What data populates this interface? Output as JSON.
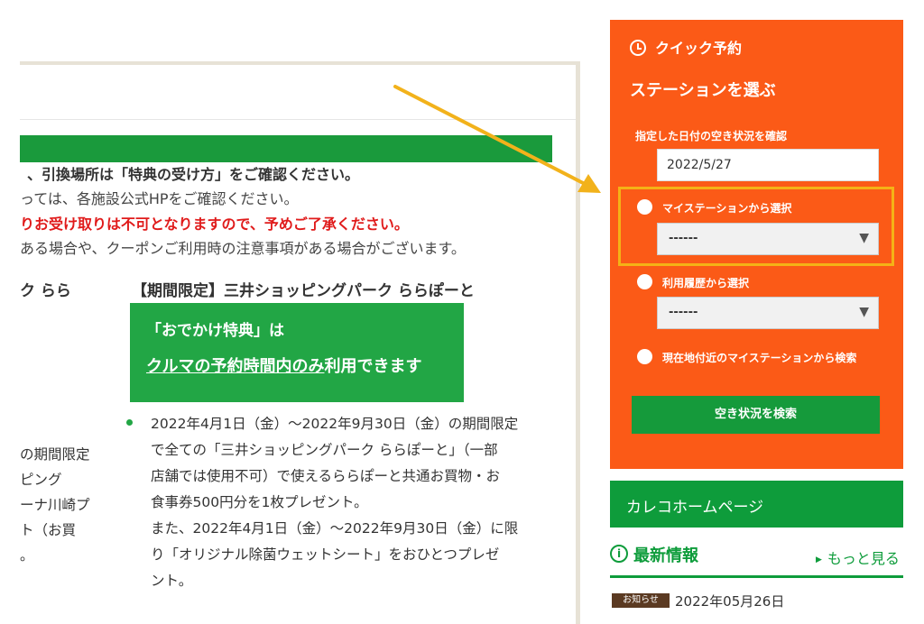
{
  "left": {
    "notice_bold": "、引換場所は「特典の受け方」をご確認ください。",
    "notice_2": "っては、各施設公式HPをご確認ください。",
    "notice_red": "りお受け取りは不可となりますので、予めご了承ください。",
    "notice_4": "ある場合や、クーポンご利用時の注意事項がある場合がございます。",
    "col_left_head": "ク らら",
    "col_right_head": "【期間限定】三井ショッピングパーク ららぽーと",
    "promo_line1": "「おでかけ特典」は",
    "promo_line2_underlined": "クルマの予約時間内のみ",
    "promo_line2_rest": "利用できます",
    "para_lines": [
      "2022年4月1日（金）～2022年9月30日（金）の期間限定",
      "で全ての「三井ショッピングパーク ららぽーと」（一部",
      "店舗では使用不可）で使えるららぽーと共通お買物・お",
      "食事券500円分を1枚プレゼント。",
      "また、2022年4月1日（金）～2022年9月30日（金）に限",
      "り「オリジナル除菌ウェットシート」をおひとつプレゼ",
      "ント。"
    ],
    "side_fragments": [
      "の期間限定",
      "ピング",
      "ーナ川崎プ",
      "ト（お買",
      "。"
    ]
  },
  "quick": {
    "title": "クイック予約",
    "subtitle": "ステーションを選ぶ",
    "date_label": "指定した日付の空き状況を確認",
    "date_value": "2022/5/27",
    "option1_label": "マイステーションから選択",
    "option1_value": "------",
    "option2_label": "利用履歴から選択",
    "option2_value": "------",
    "option3_label": "現在地付近のマイステーションから検索",
    "search_button": "空き状況を検索",
    "caret": "▼"
  },
  "sidebar": {
    "home_link": "カレコホームページ",
    "news_title": "最新情報",
    "more_link": "もっと見る",
    "news_badge": "お知らせ",
    "news_date": "2022年05月26日"
  },
  "colors": {
    "panel_orange": "#fb5a17",
    "green": "#0e9c3b",
    "highlight_yellow": "#f4b216",
    "arrow_yellow": "#f2b21b",
    "notice_red": "#e01b1b"
  }
}
